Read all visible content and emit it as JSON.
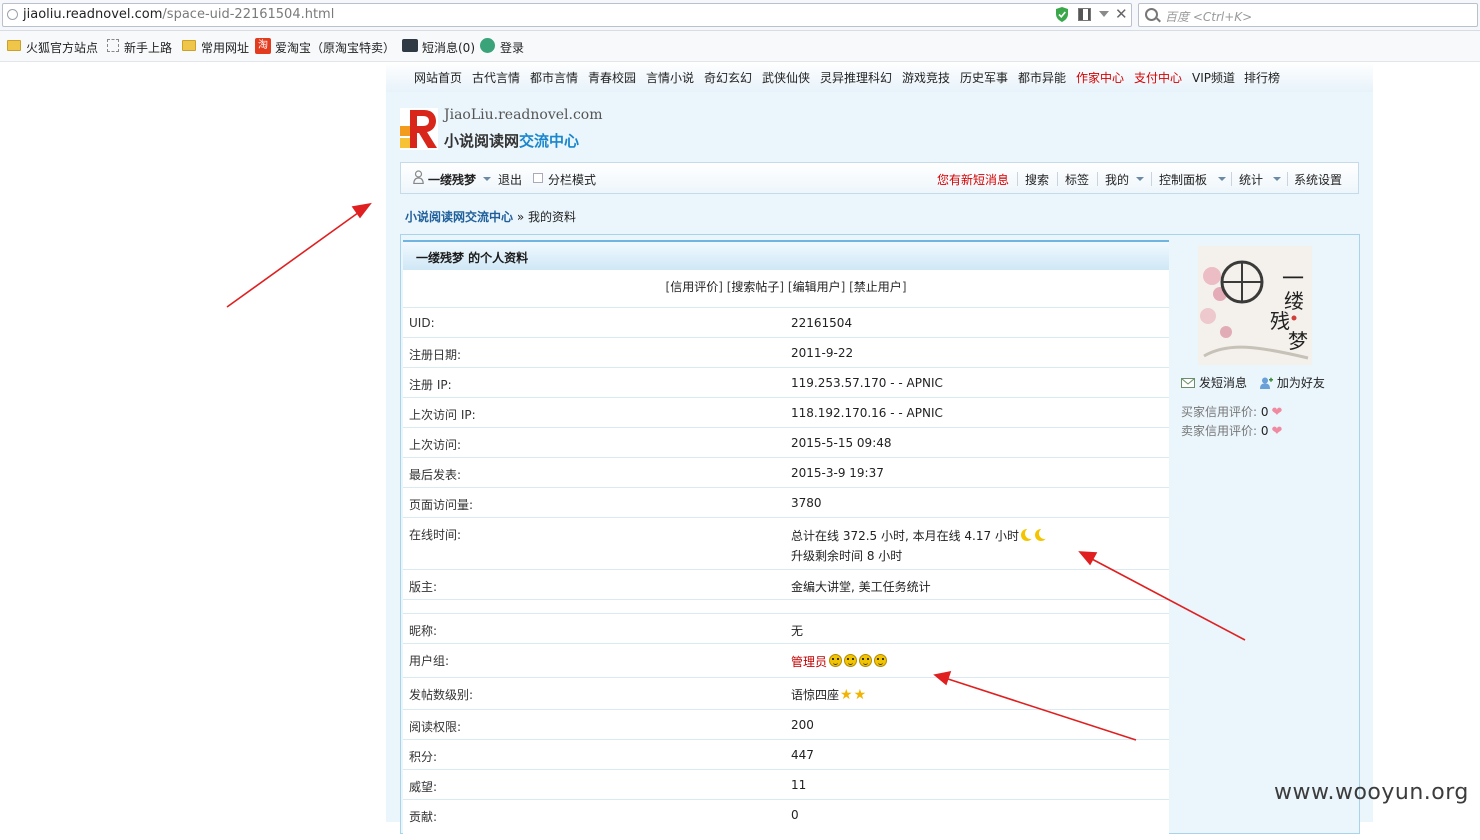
{
  "browser": {
    "url_host": "jiaoliu.readnovel.com",
    "url_path": "/space-uid-22161504.html",
    "search_placeholder": "百度 <Ctrl+K>",
    "bookmarks": [
      "火狐官方站点",
      "新手上路",
      "常用网址",
      "爱淘宝（原淘宝特卖）",
      "短消息(0)",
      "登录"
    ],
    "taobao_glyph": "淘"
  },
  "topnav": [
    "网站首页",
    "古代言情",
    "都市言情",
    "青春校园",
    "言情小说",
    "奇幻玄幻",
    "武侠仙侠",
    "灵异推理科幻",
    "游戏竞技",
    "历史军事",
    "都市异能",
    "作家中心",
    "支付中心",
    "VIP频道",
    "排行榜"
  ],
  "logo": {
    "domain": "JiaoLiu.readnovel.com",
    "name_prefix": "小说阅读网",
    "name_suffix": "交流中心"
  },
  "userbar": {
    "username": "一缕残梦",
    "logout": "退出",
    "split_mode": "分栏模式",
    "new_message": "您有新短消息",
    "search": "搜索",
    "tags": "标签",
    "mine": "我的",
    "control_panel": "控制面板",
    "stats": "统计",
    "system_settings": "系统设置"
  },
  "breadcrumb": {
    "home": "小说阅读网交流中心",
    "separator": "»",
    "current": "我的资料"
  },
  "profile": {
    "title": "一缕残梦 的个人资料",
    "links": [
      "信用评价",
      "搜索帖子",
      "编辑用户",
      "禁止用户"
    ],
    "rows": [
      {
        "label": "UID:",
        "value": "22161504"
      },
      {
        "label": "注册日期:",
        "value": "2011-9-22"
      },
      {
        "label": "注册 IP:",
        "value": "119.253.57.170 - - APNIC"
      },
      {
        "label": "上次访问 IP:",
        "value": "118.192.170.16 - - APNIC"
      },
      {
        "label": "上次访问:",
        "value": "2015-5-15 09:48"
      },
      {
        "label": "最后发表:",
        "value": "2015-3-9 19:37"
      },
      {
        "label": "页面访问量:",
        "value": "3780"
      },
      {
        "label": "在线时间:",
        "value": "总计在线 372.5 小时, 本月在线 4.17 小时",
        "value2": "升级剩余时间 8 小时"
      },
      {
        "label": "版主:",
        "value": "金编大讲堂, 美工任务统计"
      },
      {
        "label": "昵称:",
        "value": "无"
      },
      {
        "label": "用户组:",
        "value": "管理员"
      },
      {
        "label": "发帖数级别:",
        "value": "语惊四座"
      },
      {
        "label": "阅读权限:",
        "value": "200"
      },
      {
        "label": "积分:",
        "value": "447"
      },
      {
        "label": "威望:",
        "value": "11"
      },
      {
        "label": "贡献:",
        "value": "0"
      }
    ]
  },
  "side": {
    "avatar_text": [
      "一",
      "缕",
      "残",
      "梦"
    ],
    "send_message": "发短消息",
    "add_friend": "加为好友",
    "buyer_credit_label": "买家信用评价:",
    "buyer_credit_value": "0",
    "seller_credit_label": "卖家信用评价:",
    "seller_credit_value": "0"
  },
  "watermark": "www.wooyun.org",
  "colors": {
    "accent_red": "#d60000",
    "link_blue": "#1f5f9a",
    "panel_bg": "#eaf5fc",
    "arrow_red": "#e02020"
  }
}
